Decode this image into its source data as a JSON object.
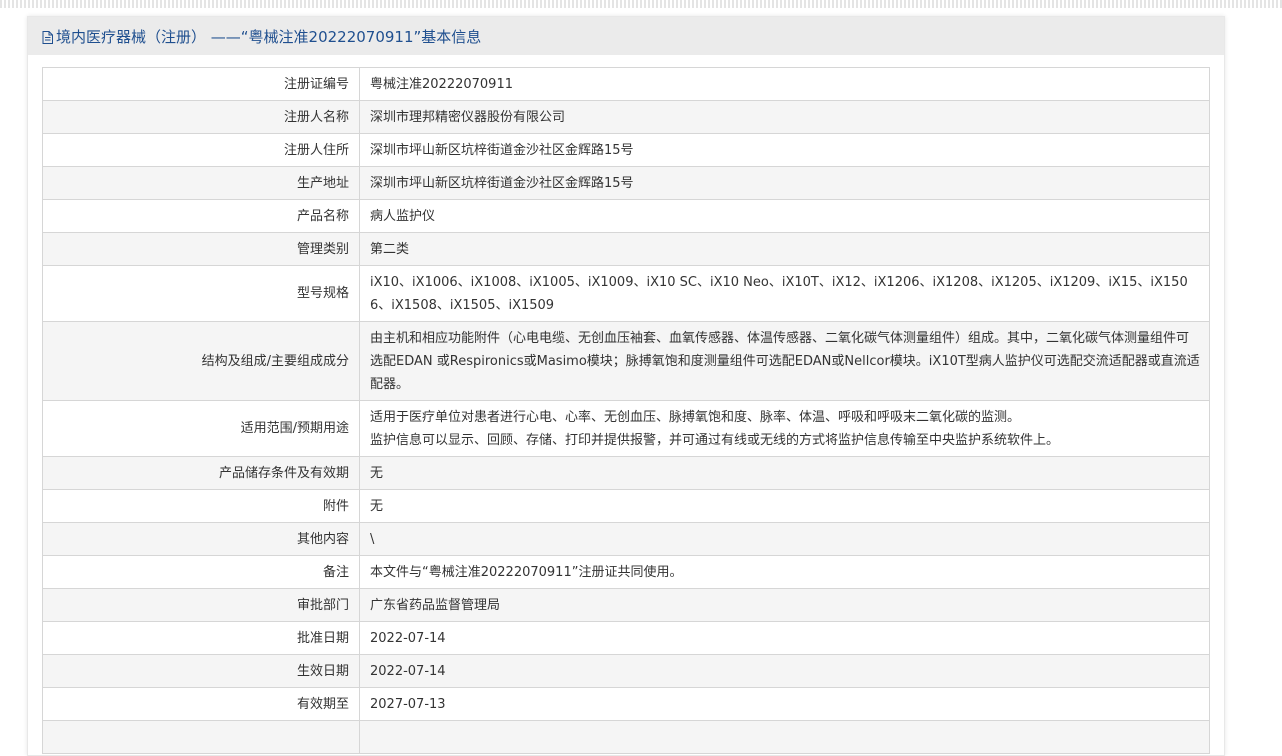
{
  "header": {
    "title": "境内医疗器械（注册） ——“粤械注准20222070911”基本信息"
  },
  "rows": [
    {
      "label": "注册证编号",
      "value": "粤械注准20222070911"
    },
    {
      "label": "注册人名称",
      "value": "深圳市理邦精密仪器股份有限公司"
    },
    {
      "label": "注册人住所",
      "value": "深圳市坪山新区坑梓街道金沙社区金辉路15号"
    },
    {
      "label": "生产地址",
      "value": "深圳市坪山新区坑梓街道金沙社区金辉路15号"
    },
    {
      "label": "产品名称",
      "value": "病人监护仪"
    },
    {
      "label": "管理类别",
      "value": "第二类"
    },
    {
      "label": "型号规格",
      "value": "iX10、iX1006、iX1008、iX1005、iX1009、iX10 SC、iX10 Neo、iX10T、iX12、iX1206、iX1208、iX1205、iX1209、iX15、iX1506、iX1508、iX1505、iX1509"
    },
    {
      "label": "结构及组成/主要组成成分",
      "value": "由主机和相应功能附件（心电电缆、无创血压袖套、血氧传感器、体温传感器、二氧化碳气体测量组件）组成。其中，二氧化碳气体测量组件可选配EDAN 或Respironics或Masimo模块；脉搏氧饱和度测量组件可选配EDAN或Nellcor模块。iX10T型病人监护仪可选配交流适配器或直流适配器。"
    },
    {
      "label": "适用范围/预期用途",
      "value": "适用于医疗单位对患者进行心电、心率、无创血压、脉搏氧饱和度、脉率、体温、呼吸和呼吸末二氧化碳的监测。\n监护信息可以显示、回顾、存储、打印并提供报警，并可通过有线或无线的方式将监护信息传输至中央监护系统软件上。"
    },
    {
      "label": "产品储存条件及有效期",
      "value": "无"
    },
    {
      "label": "附件",
      "value": "无"
    },
    {
      "label": "其他内容",
      "value": "\\"
    },
    {
      "label": "备注",
      "value": "本文件与“粤械注准20222070911”注册证共同使用。"
    },
    {
      "label": "审批部门",
      "value": "广东省药品监督管理局"
    },
    {
      "label": "批准日期",
      "value": "2022-07-14"
    },
    {
      "label": "生效日期",
      "value": "2022-07-14"
    },
    {
      "label": "有效期至",
      "value": "2027-07-13"
    },
    {
      "label": "",
      "value": ""
    }
  ],
  "icons": {
    "header_icon": "document-icon"
  },
  "colors": {
    "title": "#1f4f8f",
    "header_bg": "#ebebeb",
    "row_alt": "#f5f5f5",
    "border": "#d6d6d6"
  }
}
